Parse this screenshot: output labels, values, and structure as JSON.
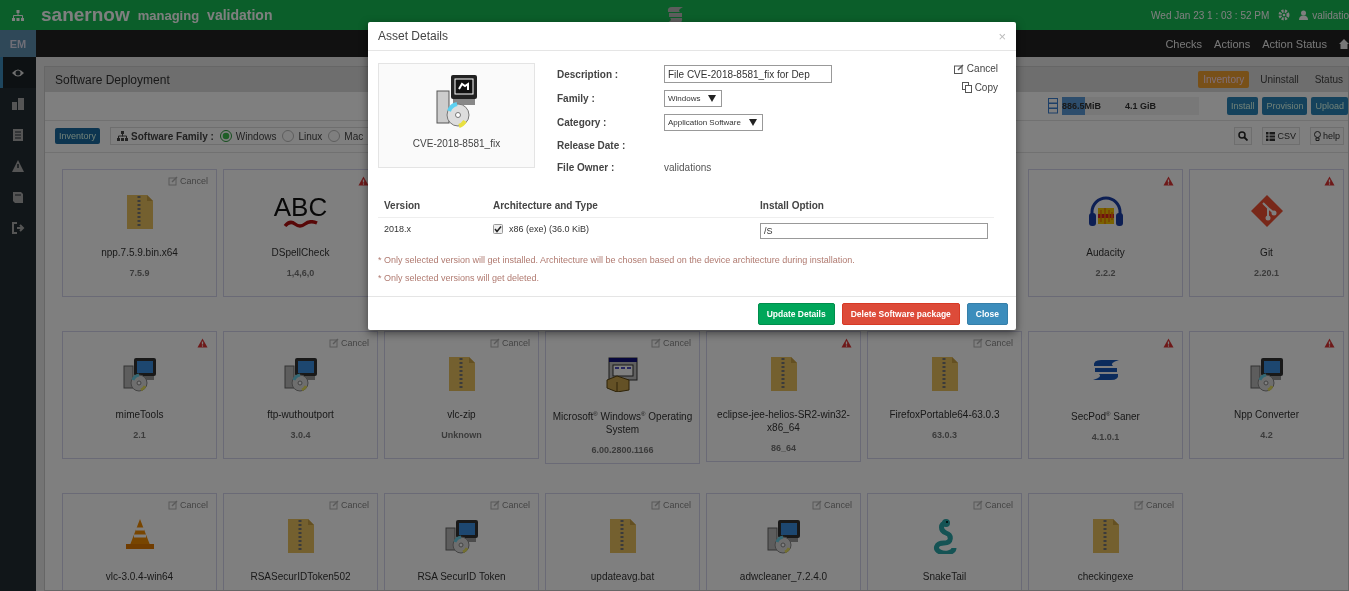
{
  "top_bar": {
    "brand": "sanernow",
    "mode": "managing",
    "account": "validation",
    "clock": "Wed Jan 23  1 : 03 : 52 PM",
    "user": "validatio"
  },
  "nav": {
    "badge": "EM",
    "links": [
      "Checks",
      "Actions",
      "Action Status"
    ]
  },
  "sidebar": {
    "items": [
      {
        "kind": "view",
        "selected": true
      },
      {
        "kind": "buildings",
        "selected": false
      },
      {
        "kind": "list",
        "selected": false
      },
      {
        "kind": "warning",
        "selected": false
      },
      {
        "kind": "book",
        "selected": false
      },
      {
        "kind": "logout",
        "selected": false
      }
    ]
  },
  "panel": {
    "title": "Software Deployment",
    "tabs": [
      {
        "label": "Inventory",
        "selected": true
      },
      {
        "label": "Uninstall",
        "selected": false
      },
      {
        "label": "Status",
        "selected": false
      }
    ],
    "storage": {
      "used": "886.5MiB",
      "total": "4.1 GiB",
      "level": 0.17
    },
    "actions": [
      "Install",
      "Provision",
      "Upload"
    ],
    "filter": {
      "button": "Inventory",
      "label": "Software Family :",
      "options": [
        {
          "label": "Windows",
          "selected": true
        },
        {
          "label": "Linux",
          "selected": false
        },
        {
          "label": "Mac",
          "selected": false
        }
      ]
    },
    "tools": [
      {
        "kind": "search"
      },
      {
        "kind": "csv",
        "label": "CSV"
      },
      {
        "kind": "help",
        "label": "help"
      }
    ],
    "cards_row_1": {
      "left": [
        {
          "name": "npp.7.5.9.bin.x64",
          "version": "7.5.9",
          "kind": "archive",
          "marker": {
            "kind": "cancel",
            "label": "Cancel"
          }
        },
        {
          "name": "DSpellCheck",
          "version": "1,4,6,0",
          "kind": "spellcheck",
          "logo_text": "ABC",
          "marker": {
            "kind": "warning"
          }
        }
      ],
      "right": [
        {
          "name": "Audacity",
          "version": "2.2.2",
          "kind": "audio",
          "marker": {
            "kind": "warning"
          }
        },
        {
          "name": "Git",
          "version": "2.20.1",
          "kind": "git",
          "marker": {
            "kind": "warning"
          }
        }
      ]
    },
    "cards_row_2": [
      {
        "name": "mimeTools",
        "version": "2.1",
        "kind": "installer",
        "marker": {
          "kind": "warning"
        }
      },
      {
        "name": "ftp-wuthoutport",
        "version": "3.0.4",
        "kind": "installer",
        "marker": {
          "kind": "cancel",
          "label": "Cancel"
        }
      },
      {
        "name": "vlc-zip",
        "version": "Unknown",
        "kind": "archive",
        "marker": {
          "kind": "cancel",
          "label": "Cancel"
        }
      },
      {
        "name": "Microsoft$^{®}$ Windows$^{®}$ Operating System",
        "version": "6.00.2800.1166",
        "kind": "setup-box",
        "marker": {
          "kind": "cancel",
          "label": "Cancel"
        }
      },
      {
        "name": "eclipse-jee-helios-SR2-win32-x86_64",
        "version": "86_64",
        "kind": "archive",
        "marker": {
          "kind": "warning"
        }
      },
      {
        "name": "FirefoxPortable64-63.0.3",
        "version": "63.0.3",
        "kind": "archive",
        "marker": {
          "kind": "cancel",
          "label": "Cancel"
        }
      },
      {
        "name": "SecPod$^{®}$ Saner",
        "version": "4.1.0.1",
        "kind": "saner",
        "marker": {
          "kind": "warning"
        }
      },
      {
        "name": "Npp Converter",
        "version": "4.2",
        "kind": "installer",
        "marker": {
          "kind": "warning"
        }
      }
    ],
    "cards_row_3": [
      {
        "name": "vlc-3.0.4-win64",
        "kind": "media-player",
        "marker": {
          "kind": "cancel",
          "label": "Cancel"
        }
      },
      {
        "name": "RSASecurIDToken502",
        "kind": "archive",
        "marker": {
          "kind": "cancel",
          "label": "Cancel"
        }
      },
      {
        "name": "RSA SecurID Token",
        "kind": "installer",
        "marker": {
          "kind": "cancel",
          "label": "Cancel"
        }
      },
      {
        "name": "updateavg.bat",
        "kind": "archive",
        "marker": {
          "kind": "cancel",
          "label": "Cancel"
        }
      },
      {
        "name": "adwcleaner_7.2.4.0",
        "kind": "installer",
        "marker": {
          "kind": "cancel",
          "label": "Cancel"
        }
      },
      {
        "name": "SnakeTail",
        "kind": "snake",
        "marker": {
          "kind": "cancel",
          "label": "Cancel"
        }
      },
      {
        "name": "checkingexe",
        "kind": "archive",
        "marker": {
          "kind": "cancel",
          "label": "Cancel"
        }
      }
    ]
  },
  "dialog": {
    "title": "Asset Details",
    "close": "×",
    "asset_name": "CVE-2018-8581_fix",
    "fields": [
      {
        "label": "Description :",
        "kind": "input",
        "value": "File CVE-2018-8581_fix for Dep"
      },
      {
        "label": "Family :",
        "kind": "select",
        "value": "Windows"
      },
      {
        "label": "Category :",
        "kind": "select",
        "value": "Application Software"
      },
      {
        "label": "Release Date :",
        "kind": "text"
      },
      {
        "label": "File Owner :",
        "kind": "text",
        "value": "validations"
      }
    ],
    "side_actions": [
      {
        "kind": "edit",
        "label": "Cancel"
      },
      {
        "kind": "copy",
        "label": "Copy"
      }
    ],
    "table": {
      "columns": [
        "Version",
        "Architecture and Type",
        "Install Option"
      ],
      "rows": [
        {
          "version": "2018.x",
          "architecture": "x86 (exe) (36.0 KiB)",
          "checked": true,
          "install_option": "/S"
        }
      ]
    },
    "notes": [
      "* Only selected version will get installed. Architecture will be chosen based on the device architecture during installation.",
      "* Only selected versions will get deleted."
    ],
    "buttons": [
      {
        "kind": "success",
        "label": "Update Details"
      },
      {
        "kind": "danger",
        "label": "Delete Software package"
      },
      {
        "kind": "primary",
        "label": "Close"
      }
    ]
  }
}
